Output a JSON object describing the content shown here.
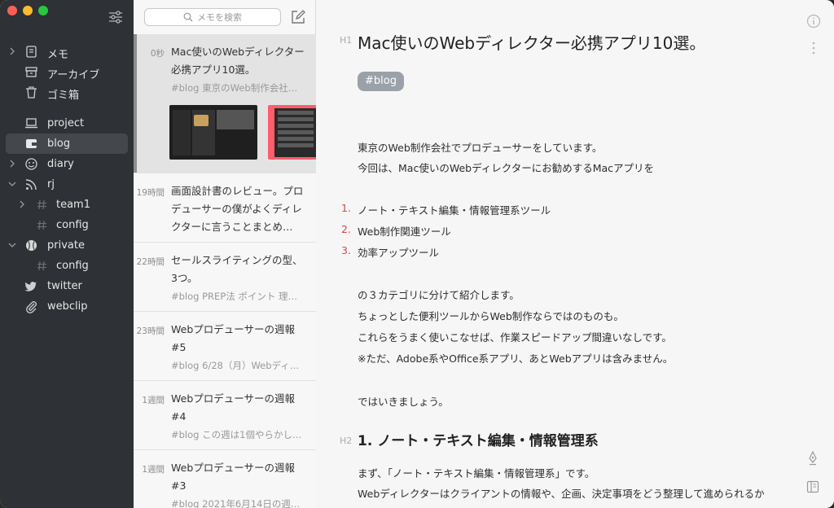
{
  "sidebar": {
    "items": [
      {
        "label": "メモ"
      },
      {
        "label": "アーカイブ"
      },
      {
        "label": "ゴミ箱"
      },
      {
        "label": "project"
      },
      {
        "label": "blog"
      },
      {
        "label": "diary"
      },
      {
        "label": "rj"
      },
      {
        "label": "team1"
      },
      {
        "label": "config"
      },
      {
        "label": "private"
      },
      {
        "label": "config"
      },
      {
        "label": "twitter"
      },
      {
        "label": "webclip"
      }
    ]
  },
  "list": {
    "search_placeholder": "メモを検索",
    "notes": [
      {
        "time": "0秒",
        "title": "Mac使いのWebディレクター必携アプリ10選。",
        "sub": "#blog 東京のWeb制作会社…"
      },
      {
        "time": "19時間",
        "title": "画面設計書のレビュー。プロデューサーの僕がよくディレクターに言うことまとめ…",
        "sub": ""
      },
      {
        "time": "22時間",
        "title": "セールスライティングの型、3つ。",
        "sub": "#blog PREP法 ポイント 理…"
      },
      {
        "time": "23時間",
        "title": "Webプロデューサーの週報 #5",
        "sub": "#blog 6/28（月）Webディ…"
      },
      {
        "time": "1週間",
        "title": "Webプロデューサーの週報 #4",
        "sub": "#blog この週は1個やらかし…"
      },
      {
        "time": "1週間",
        "title": "Webプロデューサーの週報 #3",
        "sub": "#blog 2021年6月14日の週で…"
      }
    ]
  },
  "editor": {
    "h1_mark": "H1",
    "title": "Mac使いのWebディレクター必携アプリ10選。",
    "tag": "#blog",
    "p1": "東京のWeb制作会社でプロデューサーをしています。",
    "p2": "今回は、Mac使いのWebディレクターにお勧めするMacアプリを",
    "list": [
      {
        "num": "1.",
        "text": "ノート・テキスト編集・情報管理系ツール"
      },
      {
        "num": "2.",
        "text": "Web制作関連ツール"
      },
      {
        "num": "3.",
        "text": "効率アップツール"
      }
    ],
    "p3": "の３カテゴリに分けて紹介します。",
    "p4": "ちょっとした便利ツールからWeb制作ならではのものも。",
    "p5": "これらをうまく使いこなせば、作業スピードアップ間違いなしです。",
    "p6": "※ただ、Adobe系やOffice系アプリ、あとWebアプリは含みません。",
    "p7": "ではいきましょう。",
    "h2_mark": "H2",
    "h2": "1. ノート・テキスト編集・情報管理系",
    "p8": "まず、「ノート・テキスト編集・情報管理系」です。",
    "p9": "Webディレクターはクライアントの情報や、企画、決定事項をどう整理して進められるか"
  }
}
